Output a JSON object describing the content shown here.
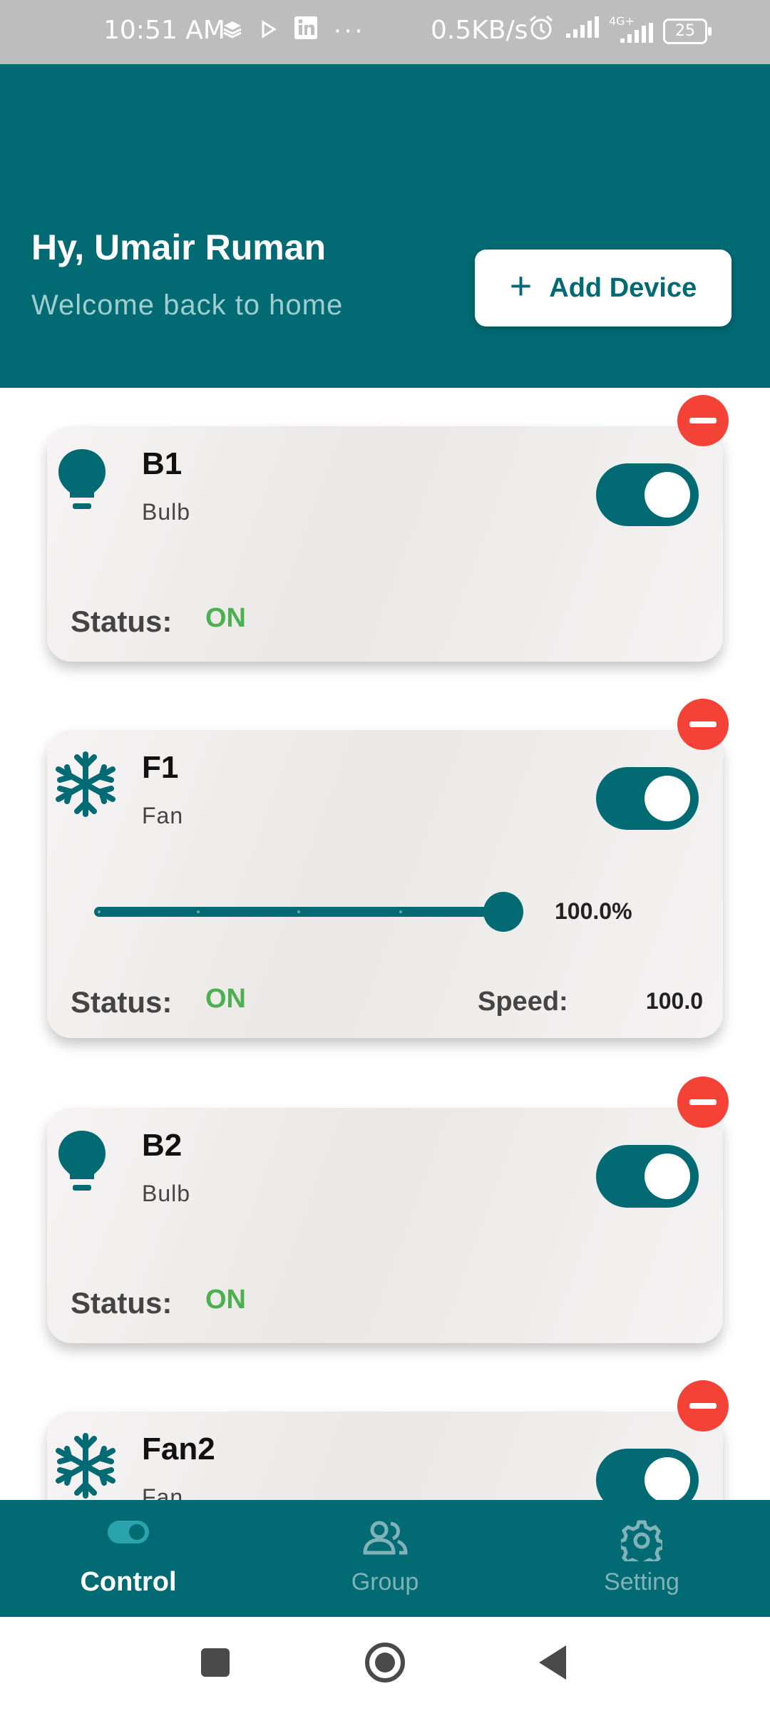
{
  "status_bar": {
    "time": "10:51 AM",
    "net_speed": "0.5KB/s",
    "network": "4G+",
    "battery": "25",
    "icons": [
      "layers-icon",
      "play-icon",
      "linkedin-icon",
      "more-icon",
      "alarm-icon",
      "signal-icon",
      "battery-icon"
    ]
  },
  "header": {
    "greeting": "Hy, Umair Ruman",
    "subtitle": "Welcome back to home",
    "add_button_label": "Add Device"
  },
  "devices": [
    {
      "name": "B1",
      "type": "Bulb",
      "icon": "lightbulb-icon",
      "status_label": "Status:",
      "status_value": "ON",
      "toggle_on": true
    },
    {
      "name": "F1",
      "type": "Fan",
      "icon": "snowflake-icon",
      "status_label": "Status:",
      "status_value": "ON",
      "toggle_on": true,
      "speed_label": "Speed:",
      "speed_value": "100.0",
      "slider_percent_text": "100.0%",
      "slider_value": 1.0
    },
    {
      "name": "B2",
      "type": "Bulb",
      "icon": "lightbulb-icon",
      "status_label": "Status:",
      "status_value": "ON",
      "toggle_on": true
    },
    {
      "name": "Fan2",
      "type": "Fan",
      "icon": "snowflake-icon",
      "toggle_on": true
    }
  ],
  "bottom_nav": {
    "items": [
      {
        "label": "Control",
        "icon": "toggle-icon",
        "active": true
      },
      {
        "label": "Group",
        "icon": "group-icon",
        "active": false
      },
      {
        "label": "Setting",
        "icon": "gear-icon",
        "active": false
      }
    ]
  },
  "colors": {
    "primary": "#016a73",
    "status_on": "#4caf50",
    "remove": "#f44336",
    "subtitle": "#9fcdd0"
  }
}
